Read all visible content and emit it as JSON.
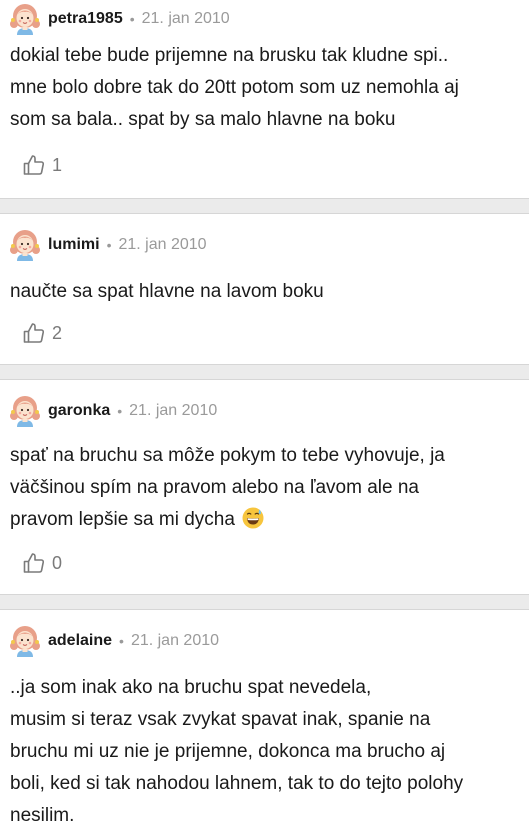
{
  "comments": [
    {
      "username": "petra1985",
      "separator": "•",
      "date": "21. jan 2010",
      "lines": [
        "dokial tebe bude prijemne na brusku tak kludne spi..",
        "mne bolo dobre tak do 20tt potom som uz nemohla aj",
        "som sa bala.. spat by sa malo hlavne na boku"
      ],
      "likes": "1"
    },
    {
      "username": "lumimi",
      "separator": "•",
      "date": "21. jan 2010",
      "lines": [
        "naučte sa spat hlavne na lavom boku"
      ],
      "likes": "2"
    },
    {
      "username": "garonka",
      "separator": "•",
      "date": "21. jan 2010",
      "lines": [
        "spať na bruchu sa môže pokym to tebe vyhovuje, ja",
        "väčšinou spím na pravom alebo na ľavom ale na",
        "pravom lepšie sa mi dycha"
      ],
      "emoji": "grinning-sweat-emoji",
      "likes": "0"
    },
    {
      "username": "adelaine",
      "separator": "•",
      "date": "21. jan 2010",
      "lines": [
        "..ja som inak ako na bruchu spat nevedela,",
        "musim si teraz vsak zvykat spavat inak, spanie na",
        "bruchu mi uz nie je prijemne, dokonca ma brucho aj",
        "boli, ked si tak nahodou lahnem, tak to do tejto polohy",
        "nesilim."
      ]
    }
  ],
  "icons": {
    "avatar": "girl-avatar-icon",
    "like": "thumbs-up-icon"
  },
  "colors": {
    "username": "#1a1a1a",
    "meta": "#9a9a9a",
    "separator_bg": "#ebebeb",
    "like_count": "#7a7a7a"
  }
}
